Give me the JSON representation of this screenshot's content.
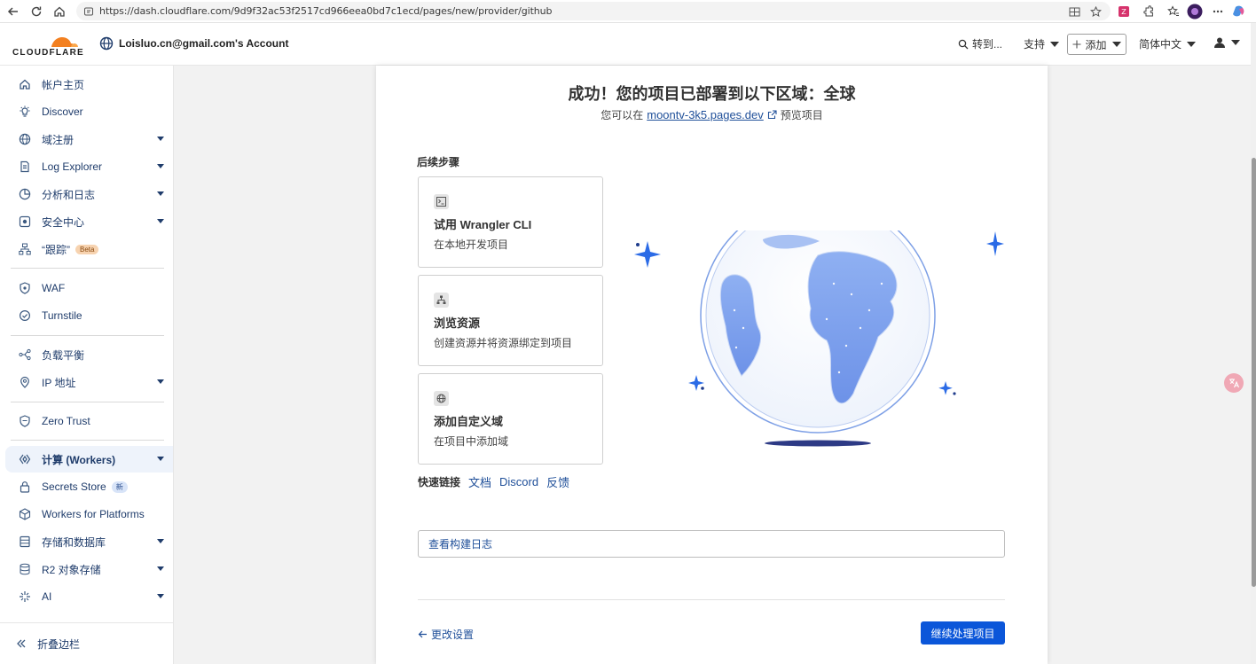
{
  "browser": {
    "url": "https://dash.cloudflare.com/9d9f32ac53f2517cd966eea0bd7c1ecd/pages/new/provider/github"
  },
  "header": {
    "logo_text": "CLOUDFLARE",
    "account_name": "Loisluo.cn@gmail.com's Account",
    "goto_label": "转到...",
    "support_label": "支持",
    "add_label": "添加",
    "language_label": "简体中文"
  },
  "sidebar": {
    "items": [
      {
        "label": "帐户主页",
        "icon": "home-icon"
      },
      {
        "label": "Discover",
        "icon": "lightbulb-icon"
      },
      {
        "label": "域注册",
        "icon": "globe-icon"
      },
      {
        "label": "Log Explorer",
        "icon": "document-icon"
      },
      {
        "label": "分析和日志",
        "icon": "chart-clock-icon"
      },
      {
        "label": "安全中心",
        "icon": "security-center-icon"
      },
      {
        "label": "“跟踪”",
        "icon": "trace-icon",
        "badge": "Beta"
      },
      {
        "label": "WAF",
        "icon": "shield-icon"
      },
      {
        "label": "Turnstile",
        "icon": "turnstile-icon"
      },
      {
        "label": "负载平衡",
        "icon": "load-balancer-icon"
      },
      {
        "label": "IP 地址",
        "icon": "location-pin-icon"
      },
      {
        "label": "Zero Trust",
        "icon": "zero-trust-icon"
      },
      {
        "label": "计算 (Workers)",
        "icon": "workers-icon"
      },
      {
        "label": "Secrets Store",
        "icon": "lock-icon",
        "badge": "新"
      },
      {
        "label": "Workers for Platforms",
        "icon": "cube-icon"
      },
      {
        "label": "存储和数据库",
        "icon": "database-icon"
      },
      {
        "label": "R2 对象存储",
        "icon": "r2-storage-icon"
      },
      {
        "label": "AI",
        "icon": "ai-sparkle-icon"
      }
    ],
    "collapse_label": "折叠边栏"
  },
  "main": {
    "title": "成功！您的项目已部署到以下区域：全球",
    "preview_prefix": "您可以在",
    "preview_link": "moontv-3k5.pages.dev",
    "preview_suffix": "预览项目",
    "next_steps_title": "后续步骤",
    "steps": [
      {
        "title": "试用 Wrangler CLI",
        "desc": "在本地开发项目",
        "icon": "terminal-icon"
      },
      {
        "title": "浏览资源",
        "desc": "创建资源并将资源绑定到项目",
        "icon": "hierarchy-icon"
      },
      {
        "title": "添加自定义域",
        "desc": "在项目中添加域",
        "icon": "globe-icon"
      }
    ],
    "quick_links_title": "快速链接",
    "quick_links": [
      "文档",
      "Discord",
      "反馈"
    ],
    "build_log_label": "查看构建日志",
    "change_settings_label": "更改设置",
    "continue_label": "继续处理项目"
  },
  "colors": {
    "primary": "#0b56d9",
    "link": "#1f4f99",
    "sidebar_text": "#1f3c6b",
    "cloudflare_orange": "#f38020"
  }
}
